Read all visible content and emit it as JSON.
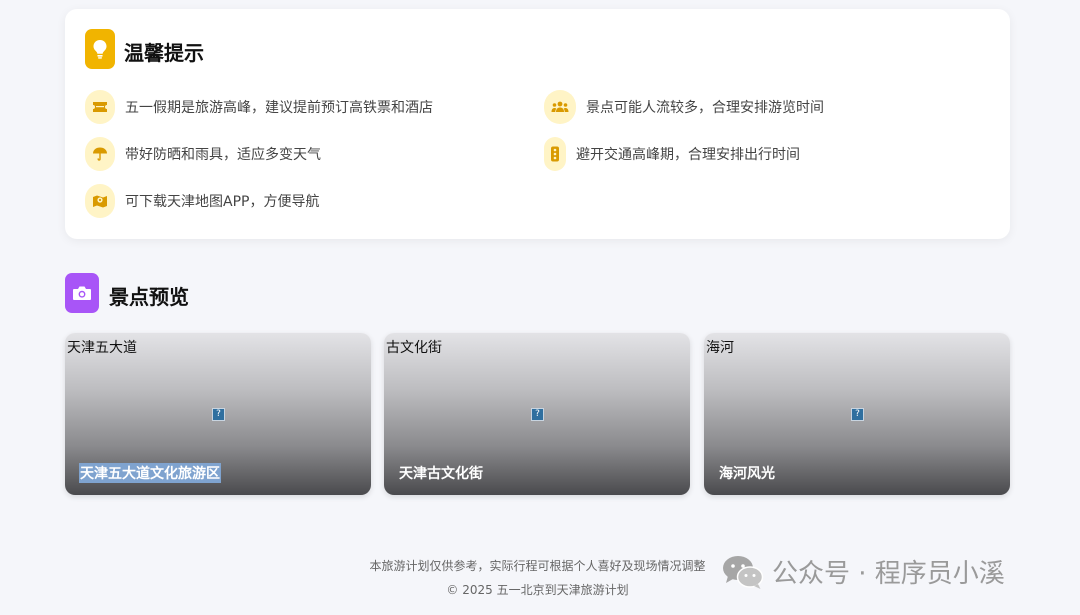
{
  "tips": {
    "title": "温馨提示",
    "items": [
      {
        "icon": "ticket-icon",
        "text": "五一假期是旅游高峰，建议提前预订高铁票和酒店"
      },
      {
        "icon": "users-icon",
        "text": "景点可能人流较多，合理安排游览时间"
      },
      {
        "icon": "umbrella-icon",
        "text": "带好防晒和雨具，适应多变天气"
      },
      {
        "icon": "traffic-light-icon",
        "text": "避开交通高峰期，合理安排出行时间"
      },
      {
        "icon": "map-icon",
        "text": "可下载天津地图APP，方便导航"
      }
    ],
    "accent": "#f1b400",
    "icon_bg": "#fff4c6"
  },
  "attractions": {
    "title": "景点预览",
    "accent": "#a855f7",
    "cards": [
      {
        "alt": "天津五大道",
        "caption": "天津五大道文化旅游区"
      },
      {
        "alt": "古文化街",
        "caption": "天津古文化街"
      },
      {
        "alt": "海河",
        "caption": "海河风光"
      }
    ]
  },
  "footer": {
    "note": "本旅游计划仅供参考，实际行程可根据个人喜好及现场情况调整",
    "copyright": "© 2025 五一北京到天津旅游计划"
  },
  "watermark": {
    "text": "公众号 · 程序员小溪"
  }
}
